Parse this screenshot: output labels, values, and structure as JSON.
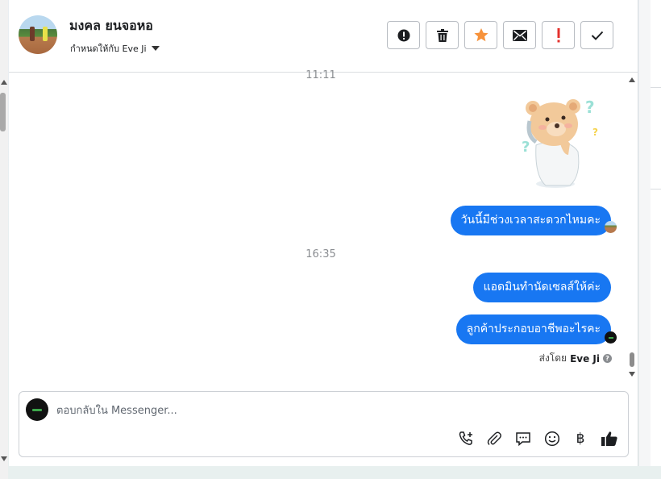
{
  "contact": {
    "name": "มงคล ยนจอหอ",
    "assigned_to": "กำหนดให้กับ Eve Ji"
  },
  "toolbar": [
    {
      "name": "spam-button",
      "icon": "alert-circle-icon"
    },
    {
      "name": "delete-button",
      "icon": "trash-icon"
    },
    {
      "name": "star-button",
      "icon": "star-icon"
    },
    {
      "name": "mark-unread-button",
      "icon": "envelope-icon"
    },
    {
      "name": "mark-important-button",
      "icon": "exclamation-icon"
    },
    {
      "name": "mark-done-button",
      "icon": "check-icon"
    }
  ],
  "conversation": {
    "time_top": "11:11",
    "time_mid": "16:35",
    "messages": [
      {
        "text": "วันนี้มีช่วงเวลาสะดวกไหมคะ"
      },
      {
        "text": "แอดมินทำนัดเซลส์ให้ค่ะ"
      },
      {
        "text": "ลูกค้าประกอบอาชีพอะไรคะ"
      }
    ],
    "sent_by_prefix": "ส่งโดย",
    "sent_by_name": "Eve Ji"
  },
  "composer": {
    "placeholder": "ตอบกลับใน Messenger..."
  },
  "colors": {
    "bubble": "#1877f2",
    "star": "#f7923b",
    "exclamation": "#e4312c"
  }
}
